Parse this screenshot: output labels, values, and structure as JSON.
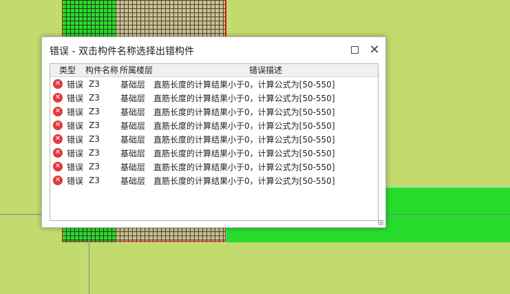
{
  "dialog": {
    "title": "错误 - 双击构件名称选择出错构件",
    "maximize_label": "",
    "close_label": "✕"
  },
  "table": {
    "columns": [
      "类型",
      "构件名称",
      "所属楼层",
      "错误描述"
    ],
    "rows": [
      {
        "type": "错误",
        "name": "Z3",
        "floor": "基础层",
        "desc": "直筋长度的计算结果小于0，计算公式为[50-550]"
      },
      {
        "type": "错误",
        "name": "Z3",
        "floor": "基础层",
        "desc": "直筋长度的计算结果小于0，计算公式为[50-550]"
      },
      {
        "type": "错误",
        "name": "Z3",
        "floor": "基础层",
        "desc": "直筋长度的计算结果小于0，计算公式为[50-550]"
      },
      {
        "type": "错误",
        "name": "Z3",
        "floor": "基础层",
        "desc": "直筋长度的计算结果小于0，计算公式为[50-550]"
      },
      {
        "type": "错误",
        "name": "Z3",
        "floor": "基础层",
        "desc": "直筋长度的计算结果小于0，计算公式为[50-550]"
      },
      {
        "type": "错误",
        "name": "Z3",
        "floor": "基础层",
        "desc": "直筋长度的计算结果小于0，计算公式为[50-550]"
      },
      {
        "type": "错误",
        "name": "Z3",
        "floor": "基础层",
        "desc": "直筋长度的计算结果小于0，计算公式为[50-550]"
      },
      {
        "type": "错误",
        "name": "Z3",
        "floor": "基础层",
        "desc": "直筋长度的计算结果小于0，计算公式为[50-550]"
      }
    ]
  },
  "icons": {
    "row_icon": "error-x-icon",
    "maximize": "maximize-icon",
    "close": "close-icon"
  },
  "colors": {
    "canvas_bg": "#c3da6f",
    "green_fill": "#27dc2b",
    "error_red": "#e23a3a",
    "red_outline": "#d01818"
  }
}
